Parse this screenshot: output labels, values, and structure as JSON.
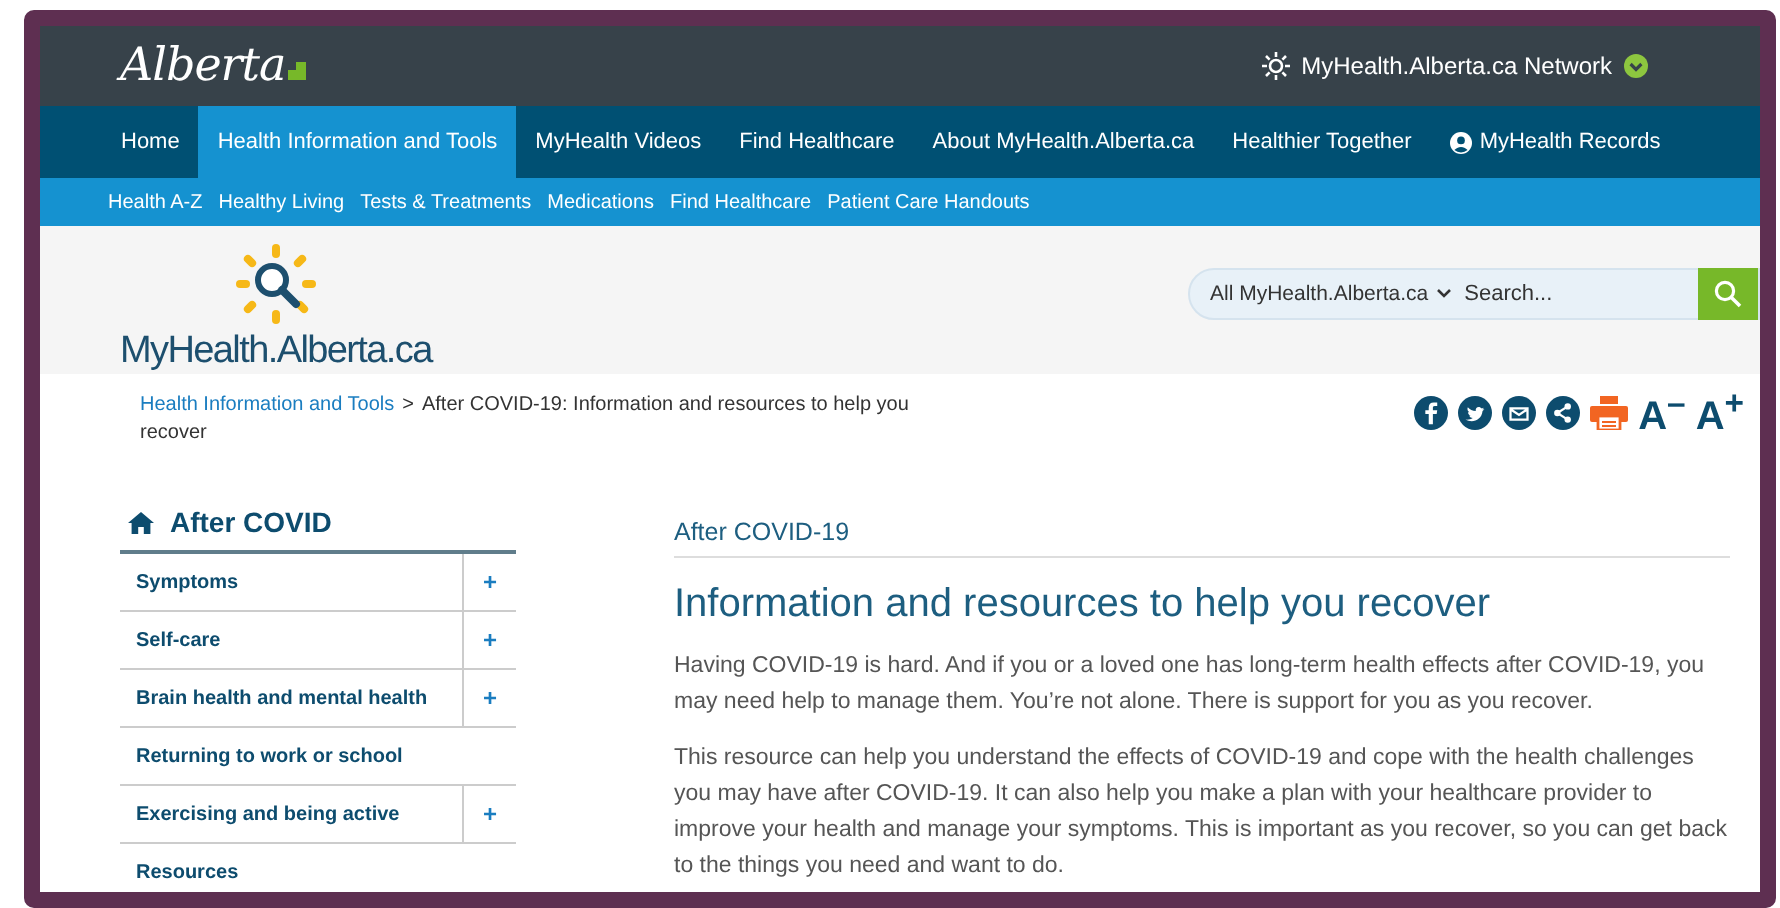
{
  "top_bar": {
    "logo": "Alberta",
    "network": "MyHealth.Alberta.ca Network"
  },
  "main_nav": [
    {
      "label": "Home",
      "selected": false
    },
    {
      "label": "Health Information and Tools",
      "selected": true
    },
    {
      "label": "MyHealth Videos",
      "selected": false
    },
    {
      "label": "Find Healthcare",
      "selected": false
    },
    {
      "label": "About MyHealth.Alberta.ca",
      "selected": false
    },
    {
      "label": "Healthier Together",
      "selected": false
    },
    {
      "label": "MyHealth Records",
      "selected": false,
      "kind": "account"
    }
  ],
  "sub_nav": [
    "Health A-Z",
    "Healthy Living",
    "Tests & Treatments",
    "Medications",
    "Find Healthcare",
    "Patient Care Handouts"
  ],
  "site_logo": "MyHealth.Alberta.ca",
  "search": {
    "scope": "All MyHealth.Alberta.ca",
    "placeholder": "Search..."
  },
  "breadcrumb": {
    "link": "Health Information and Tools",
    "separator": ">",
    "current": "After COVID-19: Information and resources to help you recover"
  },
  "text_size": {
    "decrease": "A$^{–}$",
    "increase": "A$^{+}$"
  },
  "sidebar": {
    "title": "After COVID",
    "items": [
      {
        "label": "Symptoms",
        "toggle": "+"
      },
      {
        "label": "Self-care",
        "toggle": "+"
      },
      {
        "label": "Brain health and mental health",
        "toggle": "+"
      },
      {
        "label": "Returning to work or school"
      },
      {
        "label": "Exercising and being active",
        "toggle": "+"
      },
      {
        "label": "Resources"
      }
    ]
  },
  "article": {
    "section": "After COVID-19",
    "title": "Information and resources to help you recover",
    "paragraphs": [
      "Having COVID-19 is hard. And if you or a loved one has long-term health effects after COVID-19, you may need help to manage them. You’re not alone. There is support for you as you recover.",
      "This resource can help you understand the effects of COVID-19 and cope with the health challenges you may have after COVID-19. It can also help you make a plan with your healthcare provider to improve your health and manage your symptoms. This is important as you recover, so you can get back to the things you need and want to do."
    ]
  }
}
